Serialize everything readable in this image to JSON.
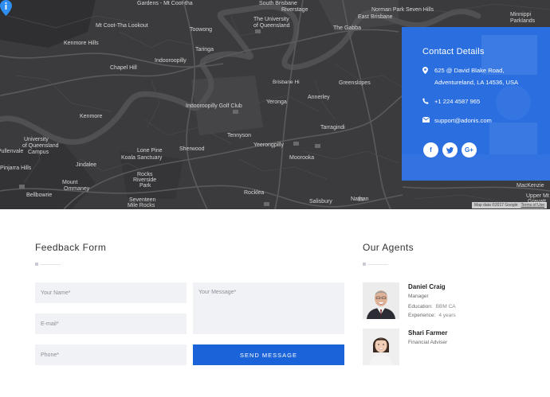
{
  "map": {
    "labels": [
      {
        "text": "Gardens - Mt Coot-tha",
        "cls": ""
      },
      {
        "text": "South Brisbane",
        "cls": ""
      },
      {
        "text": "Norman Park",
        "cls": ""
      },
      {
        "text": "Seven Hills",
        "cls": ""
      },
      {
        "text": "Riverstage",
        "cls": ""
      },
      {
        "text": "East Brisbane",
        "cls": ""
      },
      {
        "text": "Minnippi",
        "cls": ""
      },
      {
        "text": "Parklands",
        "cls": ""
      },
      {
        "text": "Mt Coot-Tha Lookout",
        "cls": ""
      },
      {
        "text": "Toowong",
        "cls": ""
      },
      {
        "text": "The Gabba",
        "cls": ""
      },
      {
        "text": "The University",
        "cls": ""
      },
      {
        "text": "of Queensland",
        "cls": ""
      },
      {
        "text": "Taringa",
        "cls": ""
      },
      {
        "text": "Kenmore Hills",
        "cls": ""
      },
      {
        "text": "Chapel Hill",
        "cls": ""
      },
      {
        "text": "Indooroopilly",
        "cls": ""
      },
      {
        "text": "Greenslopes",
        "cls": ""
      },
      {
        "text": "Brisbane Hi",
        "cls": "small"
      },
      {
        "text": "Yeronga",
        "cls": ""
      },
      {
        "text": "Annerley",
        "cls": ""
      },
      {
        "text": "Indooroopilly Golf Club",
        "cls": ""
      },
      {
        "text": "Kenmore",
        "cls": ""
      },
      {
        "text": "Tennyson",
        "cls": ""
      },
      {
        "text": "Tarragindi",
        "cls": ""
      },
      {
        "text": "University",
        "cls": ""
      },
      {
        "text": "of Queensland",
        "cls": ""
      },
      {
        "text": "Pullenvale",
        "cls": ""
      },
      {
        "text": "Campus",
        "cls": ""
      },
      {
        "text": "Pinjarra Hills",
        "cls": ""
      },
      {
        "text": "Lone Pine",
        "cls": ""
      },
      {
        "text": "Koala Sanctuary",
        "cls": ""
      },
      {
        "text": "Sherwood",
        "cls": ""
      },
      {
        "text": "Yeerongpilly",
        "cls": ""
      },
      {
        "text": "Moorooka",
        "cls": ""
      },
      {
        "text": "Jindalee",
        "cls": ""
      },
      {
        "text": "Rocks",
        "cls": ""
      },
      {
        "text": "Riverside",
        "cls": ""
      },
      {
        "text": "Park",
        "cls": ""
      },
      {
        "text": "Mount",
        "cls": ""
      },
      {
        "text": "Ommaney",
        "cls": ""
      },
      {
        "text": "Bellbowrie",
        "cls": ""
      },
      {
        "text": "Rocklea",
        "cls": ""
      },
      {
        "text": "Nathan",
        "cls": ""
      },
      {
        "text": "MacKenzie",
        "cls": ""
      },
      {
        "text": "Seventeen",
        "cls": ""
      },
      {
        "text": "Mile Rocks",
        "cls": ""
      },
      {
        "text": "Salisbury",
        "cls": ""
      },
      {
        "text": "Upper Mt",
        "cls": ""
      },
      {
        "text": "Gravatt",
        "cls": ""
      }
    ],
    "footer_data": "Map data ©2017 Google",
    "footer_terms": "Terms of Use"
  },
  "contact": {
    "title": "Contact Details",
    "address_line1": "625 @ David Blake Road,",
    "address_line2": "Adventureland, LA 14536, USA",
    "phone": "+1 224 4587 965",
    "email": "support@adonis.com",
    "socials": [
      {
        "icon": "facebook-icon",
        "glyph": "f"
      },
      {
        "icon": "twitter-icon",
        "glyph": "t"
      },
      {
        "icon": "google-plus-icon",
        "glyph": "G+"
      }
    ]
  },
  "feedback": {
    "title": "Feedback Form",
    "name_placeholder": "Your Name*",
    "email_placeholder": "E-mail*",
    "phone_placeholder": "Phone*",
    "message_placeholder": "Your Message*",
    "send_label": "SEND MESSAGE"
  },
  "agents": {
    "title": "Our Agents",
    "list": [
      {
        "name": "Daniel Craig",
        "role": "Manager",
        "education_label": "Education:",
        "education": "BBM CA",
        "experience_label": "Experience:",
        "experience": "4 years"
      },
      {
        "name": "Shari Farmer",
        "role": "Financial Adviser"
      }
    ]
  },
  "colors": {
    "map_bg": "#3c3c3e",
    "panel_blue": "#2a6ee0",
    "button_blue": "#1a63d8",
    "input_bg": "#f1f2f5"
  }
}
